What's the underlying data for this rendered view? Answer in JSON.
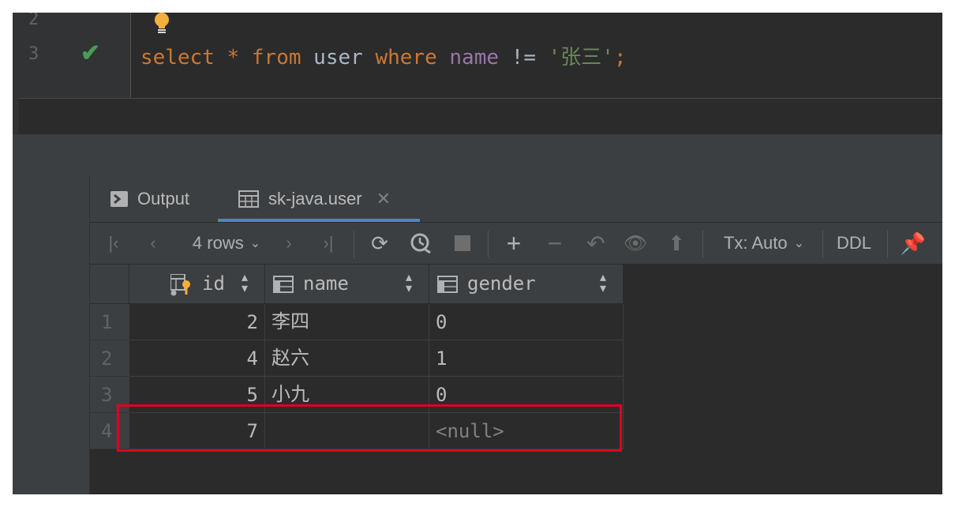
{
  "editor": {
    "line_numbers": [
      "2",
      "3"
    ],
    "status_icon": "check-icon",
    "code": {
      "select": "select",
      "star": "*",
      "from": "from",
      "table": "user",
      "where": "where",
      "column": "name",
      "op": "!=",
      "value": "'张三'",
      "semicolon": ";"
    }
  },
  "tabs": [
    {
      "label": "Output",
      "icon": "console-icon"
    },
    {
      "label": "sk-java.user",
      "icon": "table-icon",
      "active": true
    }
  ],
  "toolbar": {
    "rows_label": "4 rows",
    "tx_label": "Tx: Auto",
    "ddl_label": "DDL"
  },
  "grid": {
    "columns": [
      {
        "label": "id",
        "icon": "primary-key-icon"
      },
      {
        "label": "name",
        "icon": "column-icon"
      },
      {
        "label": "gender",
        "icon": "column-icon"
      }
    ],
    "rows": [
      {
        "no": "1",
        "id": "2",
        "name": "李四",
        "gender": "0"
      },
      {
        "no": "2",
        "id": "4",
        "name": "赵六",
        "gender": "1"
      },
      {
        "no": "3",
        "id": "5",
        "name": "小九",
        "gender": "0"
      },
      {
        "no": "4",
        "id": "7",
        "name": "",
        "gender": "<null>"
      }
    ]
  },
  "colors": {
    "keyword": "#cc7832",
    "identifier": "#9876aa",
    "string": "#6a8759",
    "highlight": "#e1001f",
    "accent": "#4a88c7"
  }
}
